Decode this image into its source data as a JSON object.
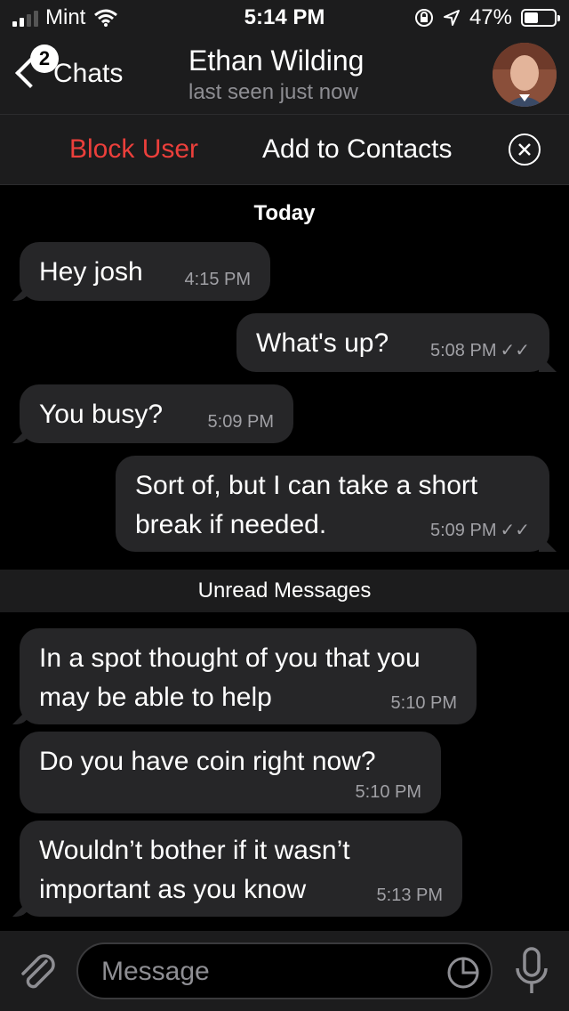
{
  "status_bar": {
    "carrier": "Mint",
    "time": "5:14 PM",
    "battery_percent": "47%"
  },
  "header": {
    "back_label": "Chats",
    "unread_badge": "2",
    "title": "Ethan Wilding",
    "subtitle": "last seen just now"
  },
  "action_bar": {
    "block_label": "Block User",
    "add_label": "Add to Contacts"
  },
  "date_separator": "Today",
  "messages": [
    {
      "direction": "in",
      "text": "Hey josh",
      "time": "4:15 PM"
    },
    {
      "direction": "out",
      "text": "What's up?",
      "time": "5:08 PM",
      "read": true
    },
    {
      "direction": "in",
      "text": "You busy?",
      "time": "5:09 PM"
    },
    {
      "direction": "out",
      "text": "Sort of, but I can take a short break if needed.",
      "time": "5:09 PM",
      "read": true
    },
    {
      "direction": "in",
      "text": "In a spot thought of you that you may be able to help",
      "time": "5:10 PM"
    },
    {
      "direction": "in",
      "text": "Do you have coin right now?",
      "time": "5:10 PM"
    },
    {
      "direction": "in",
      "text": "Wouldn’t bother if it wasn’t important as you know",
      "time": "5:13 PM"
    }
  ],
  "unread_separator": "Unread Messages",
  "input": {
    "placeholder": "Message"
  },
  "icons": {
    "attach": "paperclip-icon",
    "sticker": "sticker-icon",
    "mic": "microphone-icon",
    "close": "close-circle-icon"
  },
  "colors": {
    "block": "#eb3f3b",
    "bubble": "#262628",
    "bar": "#1c1c1d"
  }
}
